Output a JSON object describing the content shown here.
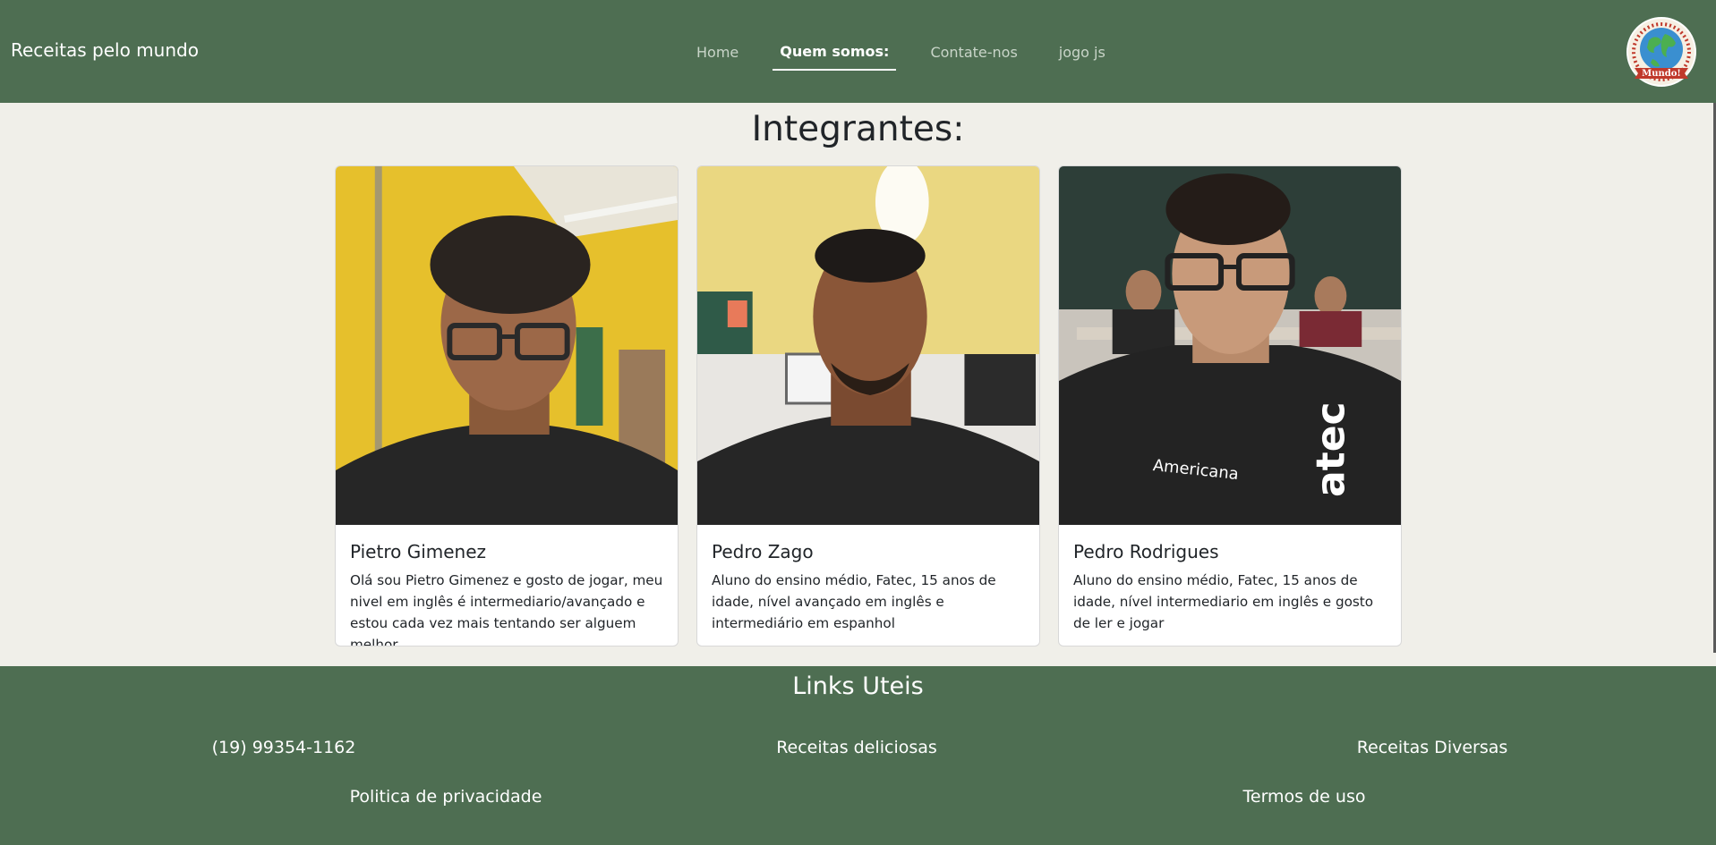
{
  "navbar": {
    "brand": "Receitas pelo mundo",
    "links": [
      {
        "label": "Home",
        "active": false
      },
      {
        "label": "Quem somos:",
        "active": true
      },
      {
        "label": "Contate-nos",
        "active": false
      },
      {
        "label": "jogo js",
        "active": false
      }
    ],
    "logo_text": "Mundo!",
    "logo_icon": "globe-logo-icon"
  },
  "main": {
    "title": "Integrantes:",
    "members": [
      {
        "name": "Pietro Gimenez",
        "description": "Olá sou Pietro Gimenez e gosto de jogar, meu nivel em inglês é intermediario/avançado e estou cada vez mais tentando ser alguem melhor.",
        "photo_icon": "portrait-photo"
      },
      {
        "name": "Pedro Zago",
        "description": "Aluno do ensino médio, Fatec, 15 anos de idade, nível avançado em inglês e intermediário em espanhol",
        "photo_icon": "portrait-photo"
      },
      {
        "name": "Pedro Rodrigues",
        "description": "Aluno do ensino médio, Fatec, 15 anos de idade, nível intermediario em inglês e gosto de ler e jogar",
        "photo_icon": "portrait-photo"
      }
    ]
  },
  "footer": {
    "title": "Links Uteis",
    "phone": "(19) 99354-1162",
    "link_delicious": "Receitas deliciosas",
    "link_diverse": "Receitas Diversas",
    "link_privacy": "Politica de privacidade",
    "link_terms": "Termos de uso"
  },
  "colors": {
    "navbar_bg": "#4e6e52",
    "page_bg": "#f0efe9",
    "card_bg": "#ffffff",
    "text": "#212529",
    "logo_ribbon": "#c0392b"
  }
}
